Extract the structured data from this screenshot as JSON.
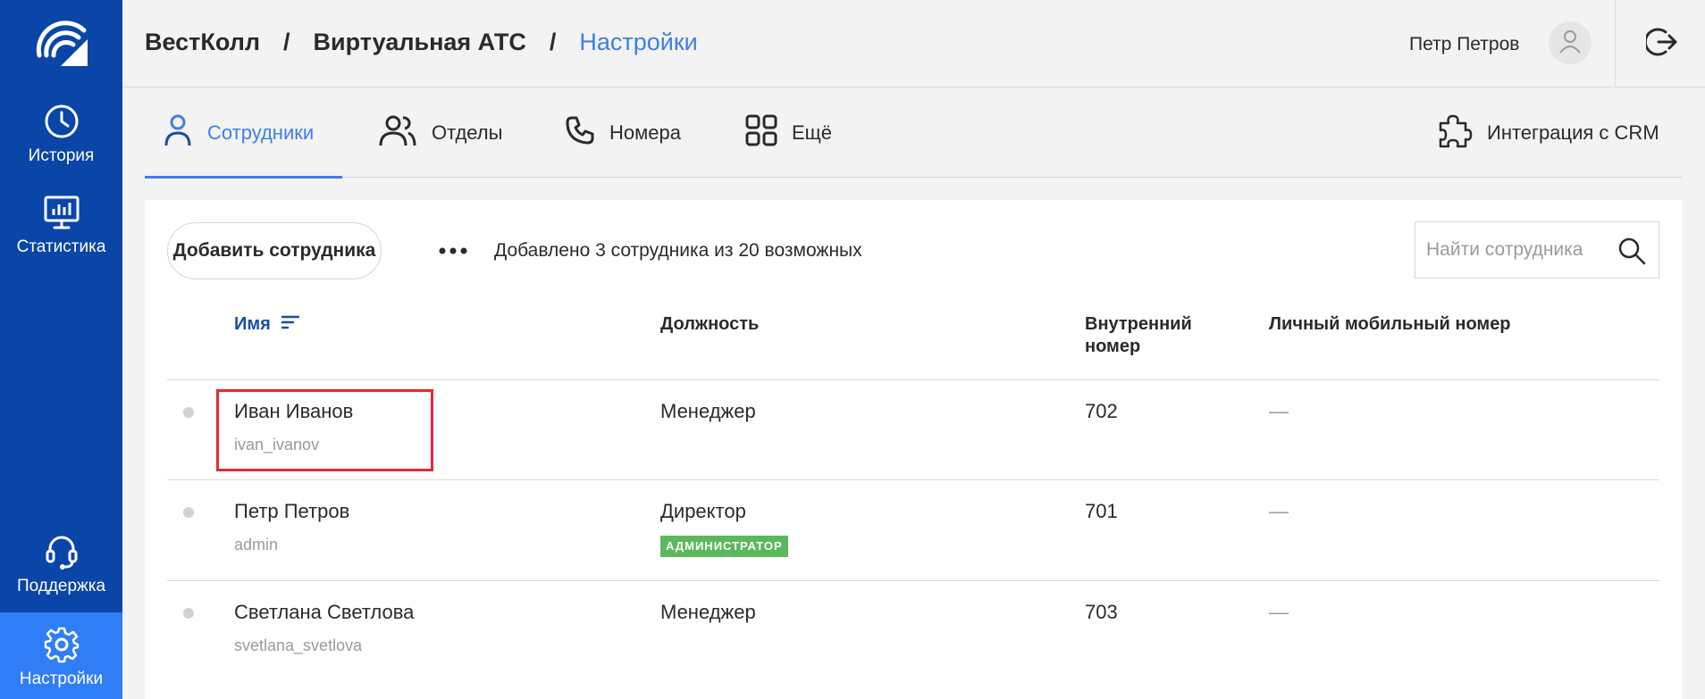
{
  "sidebar": {
    "logo": "vestcall-logo",
    "items": [
      {
        "label": "История",
        "icon": "clock-icon"
      },
      {
        "label": "Статистика",
        "icon": "monitor-chart-icon"
      },
      {
        "label": "Поддержка",
        "icon": "headset-icon"
      },
      {
        "label": "Настройки",
        "icon": "gear-icon",
        "active": true
      }
    ]
  },
  "header": {
    "breadcrumb": [
      "ВестКолл",
      "Виртуальная АТС",
      "Настройки"
    ],
    "separator": "/",
    "user_name": "Петр Петров",
    "avatar_icon": "user-icon",
    "logout_icon": "logout-icon"
  },
  "tabs": [
    {
      "label": "Сотрудники",
      "icon": "person-icon",
      "active": true
    },
    {
      "label": "Отделы",
      "icon": "people-icon"
    },
    {
      "label": "Номера",
      "icon": "phone-icon"
    },
    {
      "label": "Ещё",
      "icon": "grid-icon"
    },
    {
      "label": "Интеграция с CRM",
      "icon": "puzzle-icon"
    }
  ],
  "toolbar": {
    "add_label": "Добавить сотрудника",
    "more_icon": "more-dots-icon",
    "count_text": "Добавлено 3 сотрудника из 20 возможных",
    "search_placeholder": "Найти сотрудника",
    "search_value": ""
  },
  "table": {
    "columns": [
      "Имя",
      "Должность",
      "Внутренний номер",
      "Личный мобильный номер"
    ],
    "rows": [
      {
        "name": "Иван Иванов",
        "login": "ivan_ivanov",
        "position": "Менеджер",
        "badge": "",
        "extension": "702",
        "mobile": "—"
      },
      {
        "name": "Петр Петров",
        "login": "admin",
        "position": "Директор",
        "badge": "АДМИНИСТРАТОР",
        "extension": "701",
        "mobile": "—"
      },
      {
        "name": "Светлана Светлова",
        "login": "svetlana_svetlova",
        "position": "Менеджер",
        "badge": "",
        "extension": "703",
        "mobile": "—"
      }
    ]
  },
  "colors": {
    "sidebar_bg": "#0a45a8",
    "sidebar_active": "#2f7ef6",
    "accent": "#3f7fe6",
    "badge_green": "#5cb85c",
    "highlight_red": "#e02a37"
  }
}
